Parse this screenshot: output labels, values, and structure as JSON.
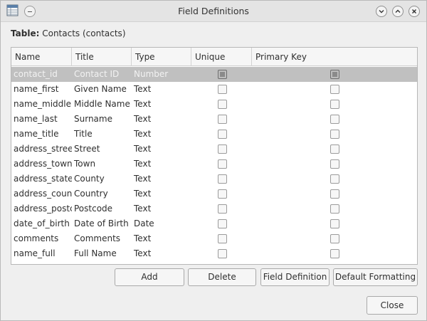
{
  "window": {
    "title": "Field Definitions"
  },
  "table_label": {
    "prefix": "Table:",
    "value": "Contacts (contacts)"
  },
  "columns": [
    "Name",
    "Title",
    "Type",
    "Unique",
    "Primary Key"
  ],
  "rows": [
    {
      "name": "contact_id",
      "title": "Contact ID",
      "type": "Number",
      "unique": true,
      "primary_key": true,
      "selected": true
    },
    {
      "name": "name_first",
      "title": "Given Name",
      "type": "Text",
      "unique": false,
      "primary_key": false
    },
    {
      "name": "name_middle",
      "title": "Middle Name",
      "type": "Text",
      "unique": false,
      "primary_key": false
    },
    {
      "name": "name_last",
      "title": "Surname",
      "type": "Text",
      "unique": false,
      "primary_key": false
    },
    {
      "name": "name_title",
      "title": "Title",
      "type": "Text",
      "unique": false,
      "primary_key": false
    },
    {
      "name": "address_street",
      "title": "Street",
      "type": "Text",
      "unique": false,
      "primary_key": false
    },
    {
      "name": "address_town",
      "title": "Town",
      "type": "Text",
      "unique": false,
      "primary_key": false
    },
    {
      "name": "address_state",
      "title": "County",
      "type": "Text",
      "unique": false,
      "primary_key": false
    },
    {
      "name": "address_country",
      "title": "Country",
      "type": "Text",
      "unique": false,
      "primary_key": false
    },
    {
      "name": "address_postcode",
      "title": "Postcode",
      "type": "Text",
      "unique": false,
      "primary_key": false
    },
    {
      "name": "date_of_birth",
      "title": "Date of Birth",
      "type": "Date",
      "unique": false,
      "primary_key": false
    },
    {
      "name": "comments",
      "title": "Comments",
      "type": "Text",
      "unique": false,
      "primary_key": false
    },
    {
      "name": "name_full",
      "title": "Full Name",
      "type": "Text",
      "unique": false,
      "primary_key": false
    }
  ],
  "buttons": {
    "add": "Add",
    "delete": "Delete",
    "field_definition": "Field Definition",
    "default_formatting": "Default Formatting",
    "close": "Close"
  },
  "icons": {
    "app": "table-window-icon",
    "minimize_left": "minimize-icon",
    "collapse": "chevron-down-icon",
    "expand": "chevron-up-icon",
    "close": "close-icon"
  },
  "colors": {
    "window_bg": "#efefef",
    "selected_row": "#c0c0c0",
    "grid_bg": "#ffffff"
  }
}
